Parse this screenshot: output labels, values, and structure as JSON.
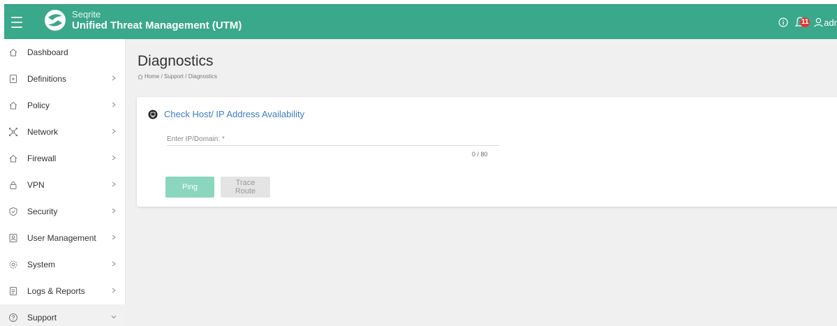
{
  "header": {
    "brand_small": "Seqrite",
    "brand_main": "Unified Threat Management (UTM)",
    "notification_count": "11",
    "user_label": "adr",
    "colors": {
      "bar": "#3aa88a",
      "badge": "#e53935"
    }
  },
  "sidebar": {
    "items": [
      {
        "label": "Dashboard",
        "icon": "home-icon",
        "has_chevron": false
      },
      {
        "label": "Definitions",
        "icon": "document-plus-icon",
        "has_chevron": true
      },
      {
        "label": "Policy",
        "icon": "home-icon",
        "has_chevron": true
      },
      {
        "label": "Network",
        "icon": "network-icon",
        "has_chevron": true
      },
      {
        "label": "Firewall",
        "icon": "home-icon",
        "has_chevron": true
      },
      {
        "label": "VPN",
        "icon": "lock-icon",
        "has_chevron": true
      },
      {
        "label": "Security",
        "icon": "shield-icon",
        "has_chevron": true
      },
      {
        "label": "User Management",
        "icon": "user-card-icon",
        "has_chevron": true
      },
      {
        "label": "System",
        "icon": "gear-icon",
        "has_chevron": true
      },
      {
        "label": "Logs & Reports",
        "icon": "report-icon",
        "has_chevron": true
      },
      {
        "label": "Support",
        "icon": "help-icon",
        "has_chevron": true,
        "expanded": true,
        "active": true
      }
    ]
  },
  "main": {
    "title": "Diagnostics",
    "breadcrumb": "Home / Support / Diagnostics",
    "card": {
      "title": "Check Host/ IP Address Availability",
      "field_label": "Enter IP/Domain: *",
      "field_value": "",
      "counter": "0 / 80",
      "ping_label": "Ping",
      "trace_label": "Trace Route"
    }
  }
}
